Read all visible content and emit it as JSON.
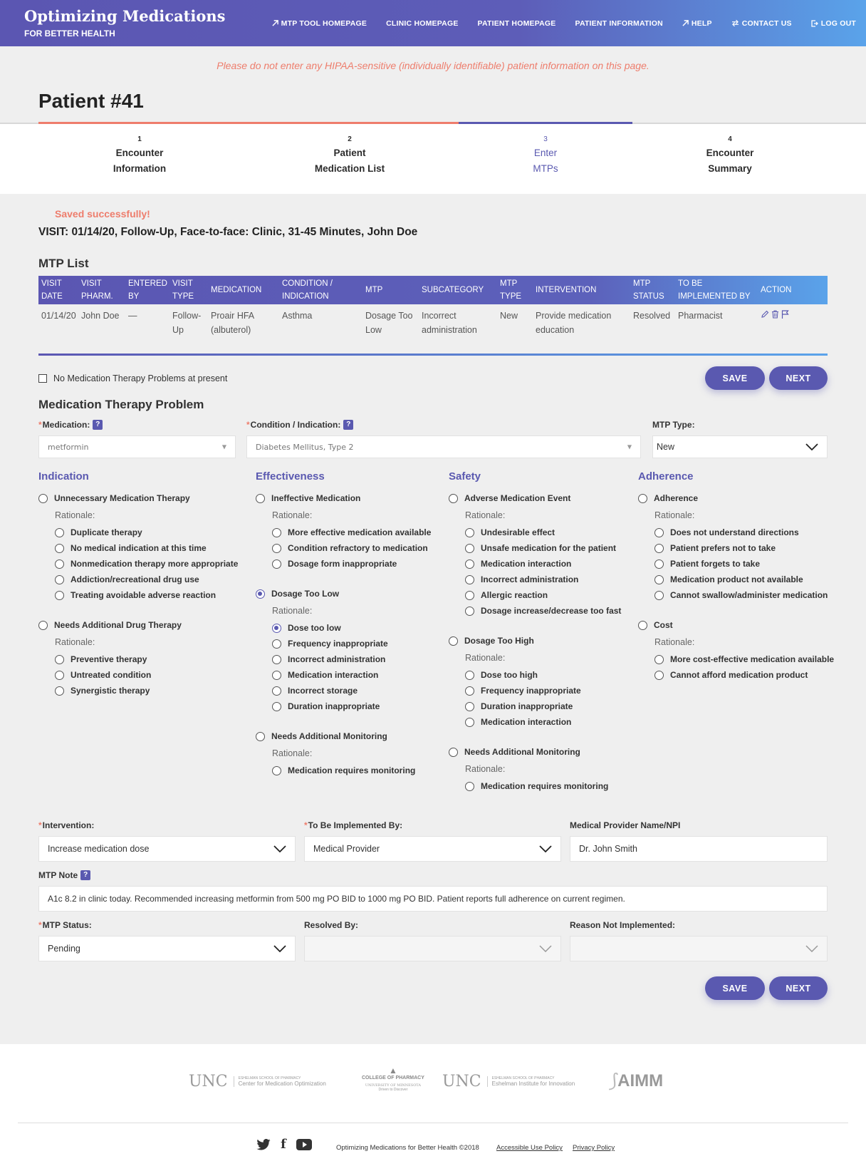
{
  "header": {
    "logo_title": "Optimizing Medications",
    "logo_subtitle": "FOR BETTER HEALTH",
    "nav": [
      {
        "label": "MTP TOOL HOMEPAGE",
        "icon": "external-arrow-icon"
      },
      {
        "label": "CLINIC HOMEPAGE",
        "icon": ""
      },
      {
        "label": "PATIENT HOMEPAGE",
        "icon": ""
      },
      {
        "label": "PATIENT INFORMATION",
        "icon": ""
      },
      {
        "label": "HELP",
        "icon": "external-arrow-icon"
      },
      {
        "label": "CONTACT US",
        "icon": "exchange-arrows-icon"
      },
      {
        "label": "LOG OUT",
        "icon": "logout-icon"
      }
    ]
  },
  "warning": "Please do not enter any HIPAA-sensitive (individually identifiable) patient information on this page.",
  "page_title": "Patient #41",
  "steps": [
    {
      "num": "1",
      "line1": "Encounter",
      "line2": "Information"
    },
    {
      "num": "2",
      "line1": "Patient",
      "line2": "Medication List"
    },
    {
      "num": "3",
      "line1": "Enter",
      "line2": "MTPs"
    },
    {
      "num": "4",
      "line1": "Encounter",
      "line2": "Summary"
    }
  ],
  "saved_message": "Saved successfully!",
  "visit": "VISIT: 01/14/20, Follow-Up, Face-to-face: Clinic, 31-45 Minutes, John Doe",
  "mtp_list": {
    "title": "MTP List",
    "headers": [
      "VISIT|DATE",
      "VISIT|PHARM.",
      "ENTERED|BY",
      "VISIT|TYPE",
      "MEDICATION",
      "CONDITION /|INDICATION",
      "MTP",
      "SUBCATEGORY",
      "MTP|TYPE",
      "INTERVENTION",
      "MTP|STATUS",
      "TO BE|IMPLEMENTED BY",
      "ACTION"
    ],
    "rows": [
      [
        "01/14/20",
        "John Doe",
        "—",
        "Follow-|Up",
        "Proair HFA|(albuterol)",
        "Asthma",
        "Dosage Too|Low",
        "Incorrect|administration",
        "New",
        "Provide medication|education",
        "Resolved",
        "Pharmacist"
      ]
    ],
    "row_actions": [
      "edit-icon",
      "trash-icon",
      "flag-icon"
    ]
  },
  "no_mtp_label": "No Medication Therapy Problems at present",
  "buttons": {
    "save": "SAVE",
    "next": "NEXT"
  },
  "form": {
    "title": "Medication Therapy Problem",
    "medication_label": "Medication:",
    "medication_value": "metformin",
    "condition_label": "Condition / Indication:",
    "condition_value": "Diabetes Mellitus, Type 2",
    "mtp_type_label": "MTP Type:",
    "mtp_type_value": "New",
    "intervention_label": "Intervention:",
    "intervention_value": "Increase medication dose",
    "implemented_label": "To Be Implemented By:",
    "implemented_value": "Medical Provider",
    "provider_label": "Medical Provider Name/NPI",
    "provider_value": "Dr. John Smith",
    "note_label": "MTP Note",
    "note_value": "A1c 8.2 in clinic today. Recommended increasing metformin from 500 mg PO BID to 1000 mg PO BID. Patient reports full adherence on current regimen.",
    "status_label": "MTP Status:",
    "status_value": "Pending",
    "resolved_label": "Resolved By:",
    "resolved_value": "",
    "reason_label": "Reason Not Implemented:",
    "reason_value": ""
  },
  "rationale_label": "Rationale:",
  "categories": [
    {
      "title": "Indication",
      "groups": [
        {
          "label": "Unnecessary Medication Therapy",
          "selected": false,
          "options": [
            {
              "label": "Duplicate therapy",
              "selected": false
            },
            {
              "label": "No medical indication at this time",
              "selected": false
            },
            {
              "label": "Nonmedication therapy more appropriate",
              "selected": false
            },
            {
              "label": "Addiction/recreational drug use",
              "selected": false
            },
            {
              "label": "Treating avoidable adverse reaction",
              "selected": false
            }
          ]
        },
        {
          "label": "Needs Additional Drug Therapy",
          "selected": false,
          "options": [
            {
              "label": "Preventive therapy",
              "selected": false
            },
            {
              "label": "Untreated condition",
              "selected": false
            },
            {
              "label": "Synergistic therapy",
              "selected": false
            }
          ]
        }
      ]
    },
    {
      "title": "Effectiveness",
      "groups": [
        {
          "label": "Ineffective Medication",
          "selected": false,
          "options": [
            {
              "label": "More effective medication available",
              "selected": false
            },
            {
              "label": "Condition refractory to medication",
              "selected": false
            },
            {
              "label": "Dosage form inappropriate",
              "selected": false
            }
          ]
        },
        {
          "label": "Dosage Too Low",
          "selected": true,
          "options": [
            {
              "label": "Dose too low",
              "selected": true
            },
            {
              "label": "Frequency inappropriate",
              "selected": false
            },
            {
              "label": "Incorrect administration",
              "selected": false
            },
            {
              "label": "Medication interaction",
              "selected": false
            },
            {
              "label": "Incorrect storage",
              "selected": false
            },
            {
              "label": "Duration inappropriate",
              "selected": false
            }
          ]
        },
        {
          "label": "Needs Additional Monitoring",
          "selected": false,
          "options": [
            {
              "label": "Medication requires monitoring",
              "selected": false
            }
          ]
        }
      ]
    },
    {
      "title": "Safety",
      "groups": [
        {
          "label": "Adverse Medication Event",
          "selected": false,
          "options": [
            {
              "label": "Undesirable effect",
              "selected": false
            },
            {
              "label": "Unsafe medication for the patient",
              "selected": false
            },
            {
              "label": "Medication interaction",
              "selected": false
            },
            {
              "label": "Incorrect administration",
              "selected": false
            },
            {
              "label": "Allergic reaction",
              "selected": false
            },
            {
              "label": "Dosage increase/decrease too fast",
              "selected": false
            }
          ]
        },
        {
          "label": "Dosage Too High",
          "selected": false,
          "options": [
            {
              "label": "Dose too high",
              "selected": false
            },
            {
              "label": "Frequency inappropriate",
              "selected": false
            },
            {
              "label": "Duration inappropriate",
              "selected": false
            },
            {
              "label": "Medication interaction",
              "selected": false
            }
          ]
        },
        {
          "label": "Needs Additional Monitoring",
          "selected": false,
          "options": [
            {
              "label": "Medication requires monitoring",
              "selected": false
            }
          ]
        }
      ]
    },
    {
      "title": "Adherence",
      "groups": [
        {
          "label": "Adherence",
          "selected": false,
          "options": [
            {
              "label": "Does not understand directions",
              "selected": false
            },
            {
              "label": "Patient prefers not to take",
              "selected": false
            },
            {
              "label": "Patient forgets to take",
              "selected": false
            },
            {
              "label": "Medication product not available",
              "selected": false
            },
            {
              "label": "Cannot swallow/administer medication",
              "selected": false
            }
          ]
        },
        {
          "label": "Cost",
          "selected": false,
          "options": [
            {
              "label": "More cost-effective medication available",
              "selected": false
            },
            {
              "label": "Cannot afford medication product",
              "selected": false
            }
          ]
        }
      ]
    }
  ],
  "footer": {
    "logos": [
      {
        "main": "UNC",
        "small1": "ESHELMAN SCHOOL OF PHARMACY",
        "small2": "Center for Medication Optimization"
      },
      {
        "main": "COLLEGE OF PHARMACY",
        "small1": "UNIVERSITY OF MINNESOTA",
        "small2": "Driven to Discover"
      },
      {
        "main": "UNC",
        "small1": "ESHELMAN SCHOOL OF PHARMACY",
        "small2": "Eshelman Institute for Innovation"
      },
      {
        "main": "AIMM",
        "small1": "",
        "small2": ""
      }
    ],
    "social": [
      "twitter-icon",
      "facebook-icon",
      "youtube-icon"
    ],
    "copyright": "Optimizing Medications for Better Health ©2018",
    "accessible": "Accessible Use Policy",
    "privacy": "Privacy Policy"
  },
  "colors": {
    "brand": "#5a59b0",
    "accent_light": "#5aa3ea",
    "warning": "#ee7d6c"
  }
}
